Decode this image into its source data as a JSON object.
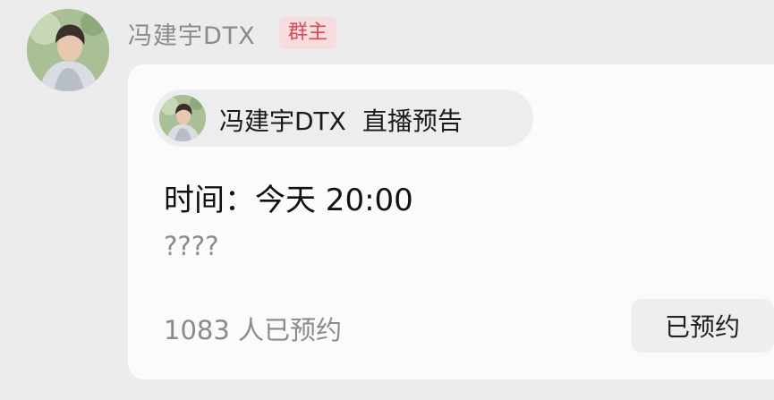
{
  "message": {
    "sender_name": "冯建宇DTX",
    "role_badge": "群主",
    "avatar_icon": "user-avatar-photo"
  },
  "live_card": {
    "host_name": "冯建宇DTX",
    "title": "直播预告",
    "time_text": "时间：今天 20:00",
    "description": "????",
    "reservation_count": "1083 人已预约",
    "reserve_button_label": "已预约"
  },
  "colors": {
    "background": "#ececec",
    "card": "#fbfbfb",
    "badge_text": "#d64a56",
    "badge_bg": "#f8dde0",
    "muted_text": "#8a8a8a"
  }
}
